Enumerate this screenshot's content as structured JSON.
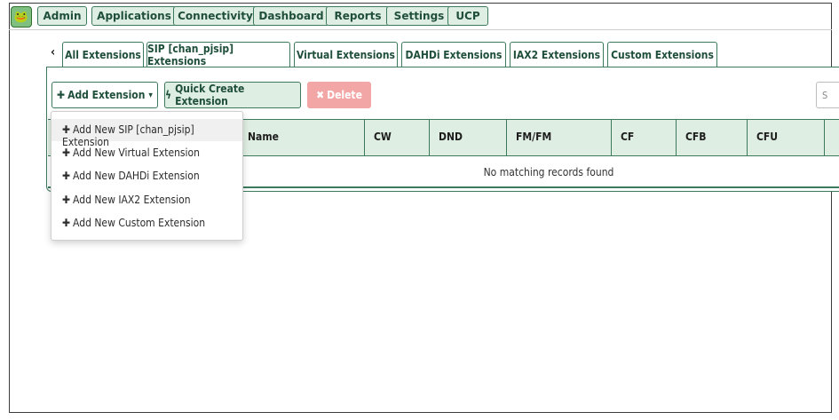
{
  "nav": {
    "logo_icon": "frog-logo-icon",
    "items": [
      "Admin",
      "Applications",
      "Connectivity",
      "Dashboard",
      "Reports",
      "Settings",
      "UCP"
    ]
  },
  "tabs": {
    "scroll_left_glyph": "‹",
    "items": [
      {
        "label": "All Extensions",
        "active": true
      },
      {
        "label": "SIP [chan_pjsip] Extensions",
        "active": false
      },
      {
        "label": "Virtual Extensions",
        "active": false
      },
      {
        "label": "DAHDi Extensions",
        "active": false
      },
      {
        "label": "IAX2 Extensions",
        "active": false
      },
      {
        "label": "Custom Extensions",
        "active": false
      }
    ]
  },
  "toolbar": {
    "add_label": "Add Extension",
    "add_icon": "plus-icon",
    "caret": "▾",
    "quick_label": "Quick Create Extension",
    "quick_icon": "bolt-icon",
    "delete_label": "Delete",
    "delete_icon": "x-icon",
    "search_partial": "S"
  },
  "dropdown": {
    "items": [
      "Add New SIP [chan_pjsip] Extension",
      "Add New Virtual Extension",
      "Add New DAHDi Extension",
      "Add New IAX2 Extension",
      "Add New Custom Extension"
    ]
  },
  "table": {
    "columns": [
      "Name",
      "CW",
      "DND",
      "FM/FM",
      "CF",
      "CFB",
      "CFU"
    ],
    "empty_message": "No matching records found"
  },
  "colors": {
    "accent": "#3d7a5c",
    "accent_light": "#dfeee3",
    "danger_light": "#f3a6a6"
  }
}
